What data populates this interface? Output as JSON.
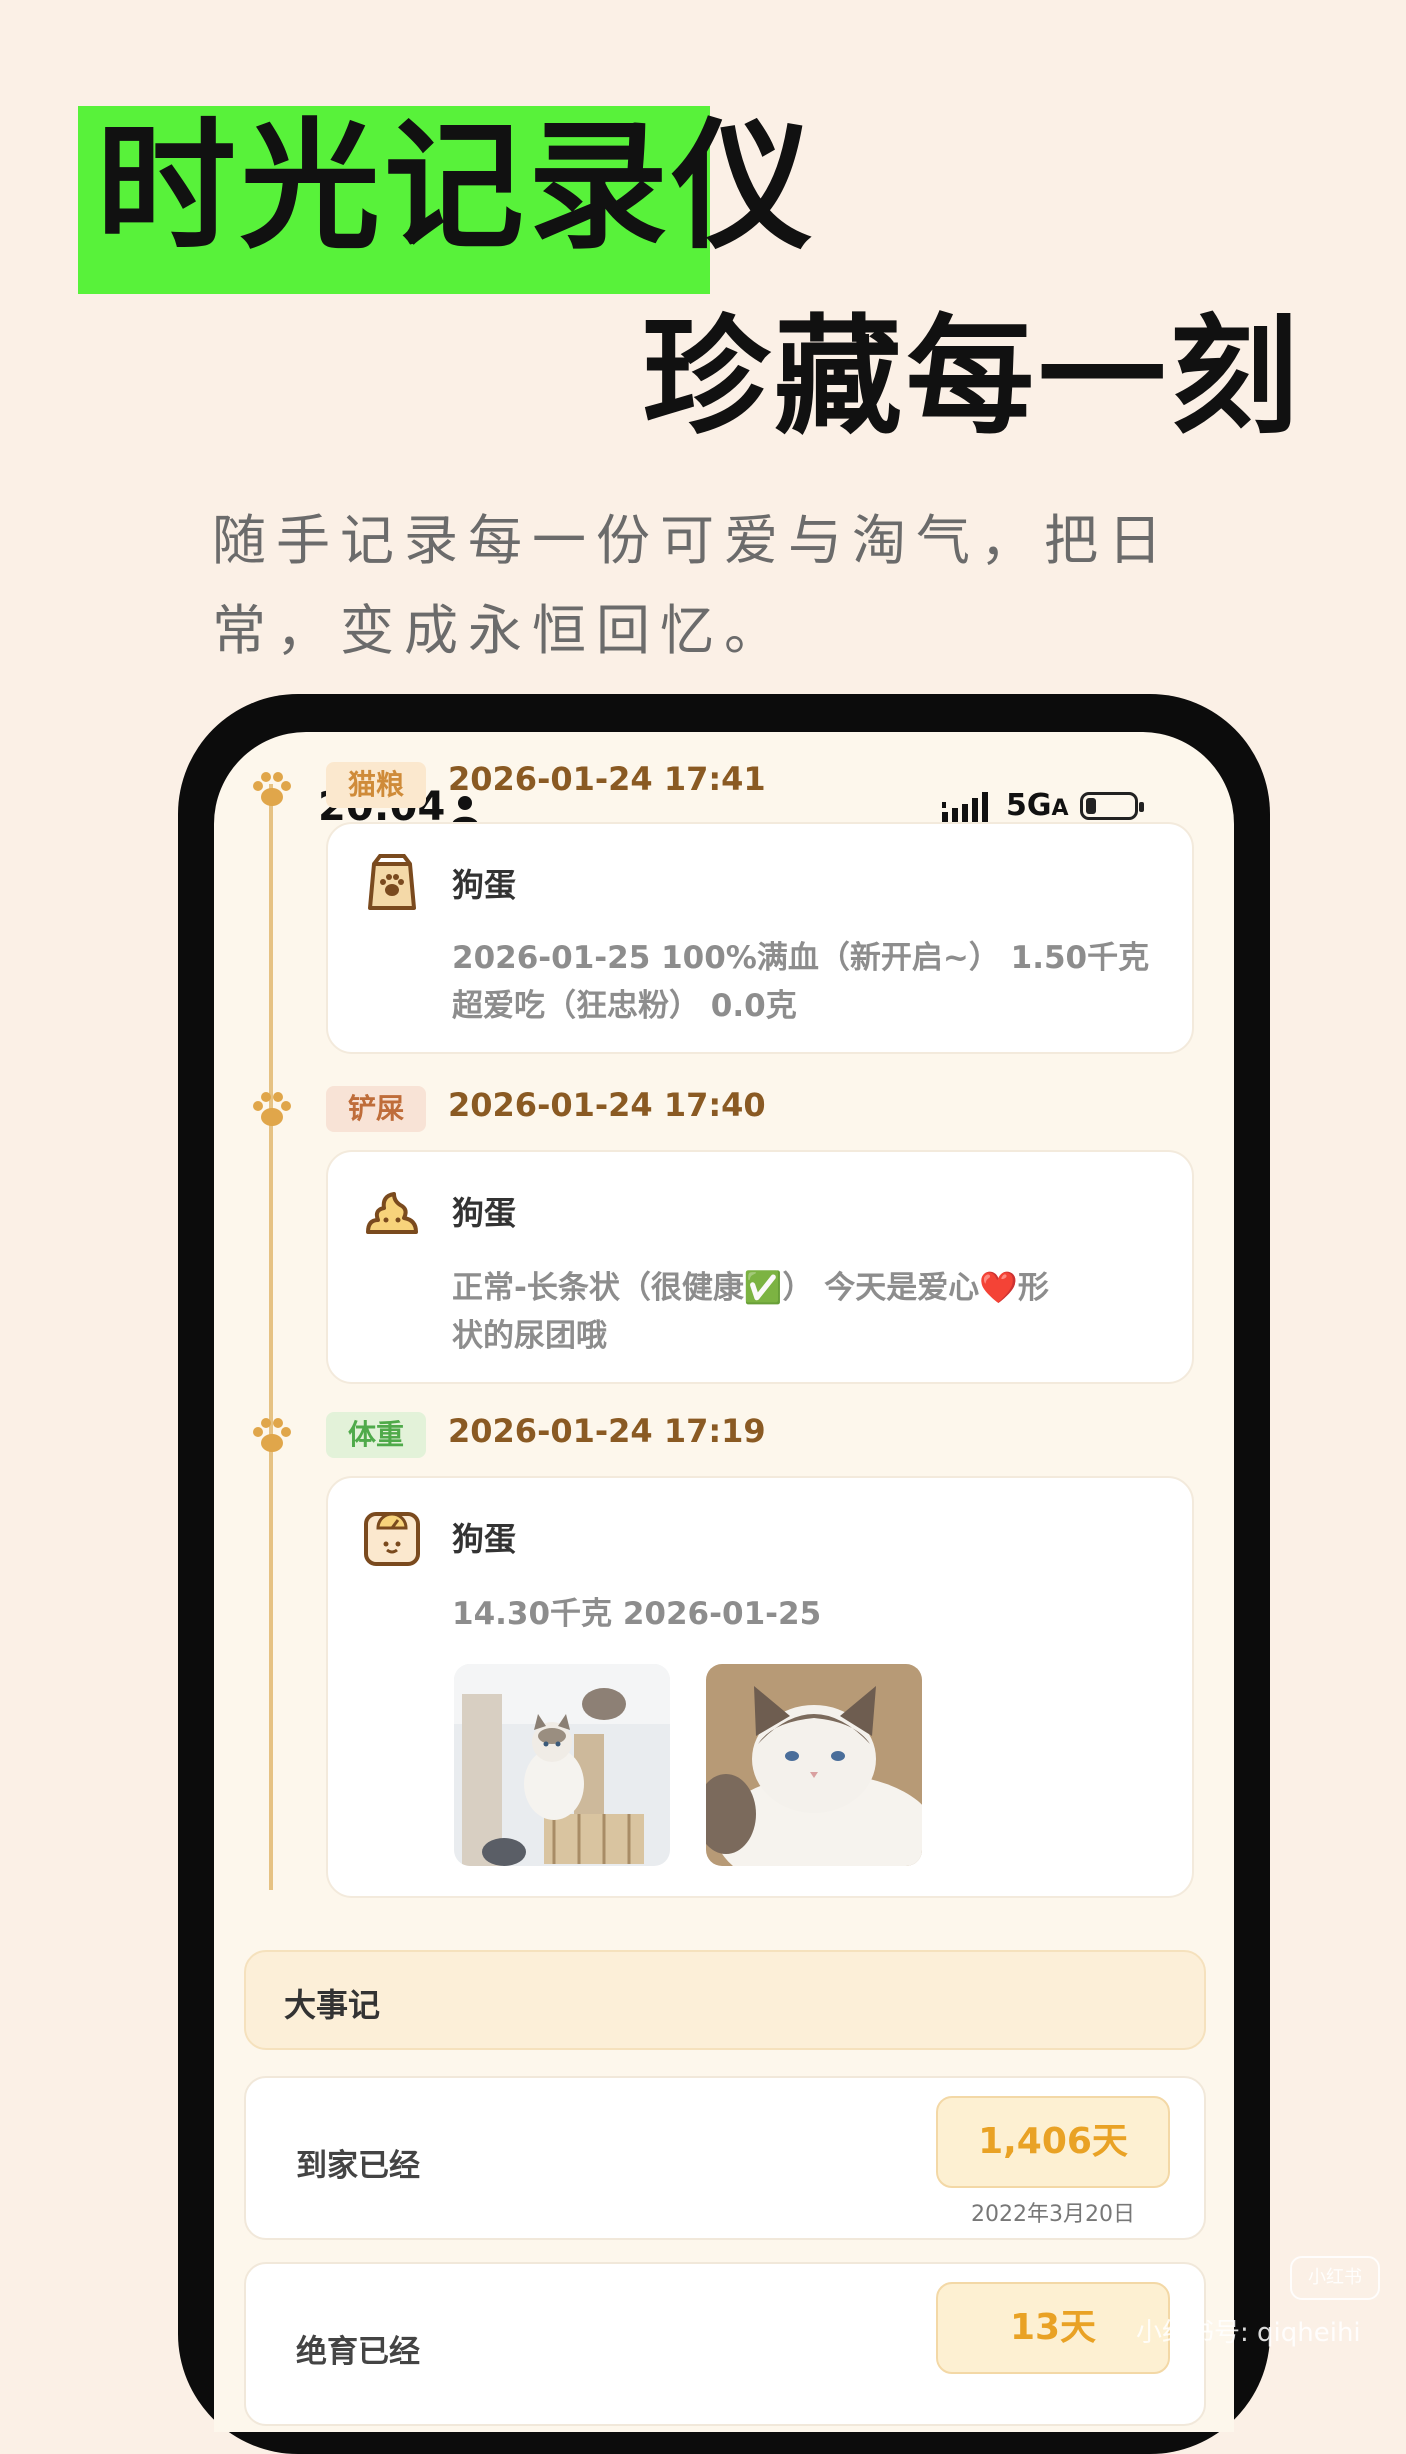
{
  "promo": {
    "title_line1": "时光记录仪",
    "title_line2": "珍藏每一刻",
    "subtitle_line1": "随手记录每一份可爱与淘气，把日",
    "subtitle_line2": "常，变成永恒回忆。"
  },
  "status_bar": {
    "time": "20:04",
    "network": "5G",
    "network_suffix": "A"
  },
  "timeline": [
    {
      "tag": "猫粮",
      "timestamp": "2026-01-24 17:41",
      "pet_name": "狗蛋",
      "icon": "food-bag-icon",
      "line1": "2026-01-25 100%满血（新开启~） 1.50千克",
      "line2": "超爱吃（狂忠粉） 0.0克"
    },
    {
      "tag": "铲屎",
      "timestamp": "2026-01-24 17:40",
      "pet_name": "狗蛋",
      "icon": "poop-icon",
      "line1": "正常-长条状（很健康✅） 今天是爱心❤️形",
      "line2": "状的尿团哦"
    },
    {
      "tag": "体重",
      "timestamp": "2026-01-24 17:19",
      "pet_name": "狗蛋",
      "icon": "scale-icon",
      "line1": "14.30千克 2026-01-25"
    }
  ],
  "milestones": {
    "header": "大事记",
    "items": [
      {
        "label": "到家已经",
        "days": "1,406天",
        "date": "2022年3月20日"
      },
      {
        "label": "绝育已经",
        "days": "13天"
      }
    ]
  },
  "watermark": {
    "logo": "小红书",
    "id_text": "小红书号: qiqheihi"
  },
  "colors": {
    "background": "#fbf0e6",
    "highlight": "#58f23a",
    "timeline_line": "#e6c283",
    "paw": "#e0a64a",
    "days_text": "#e9a225"
  }
}
